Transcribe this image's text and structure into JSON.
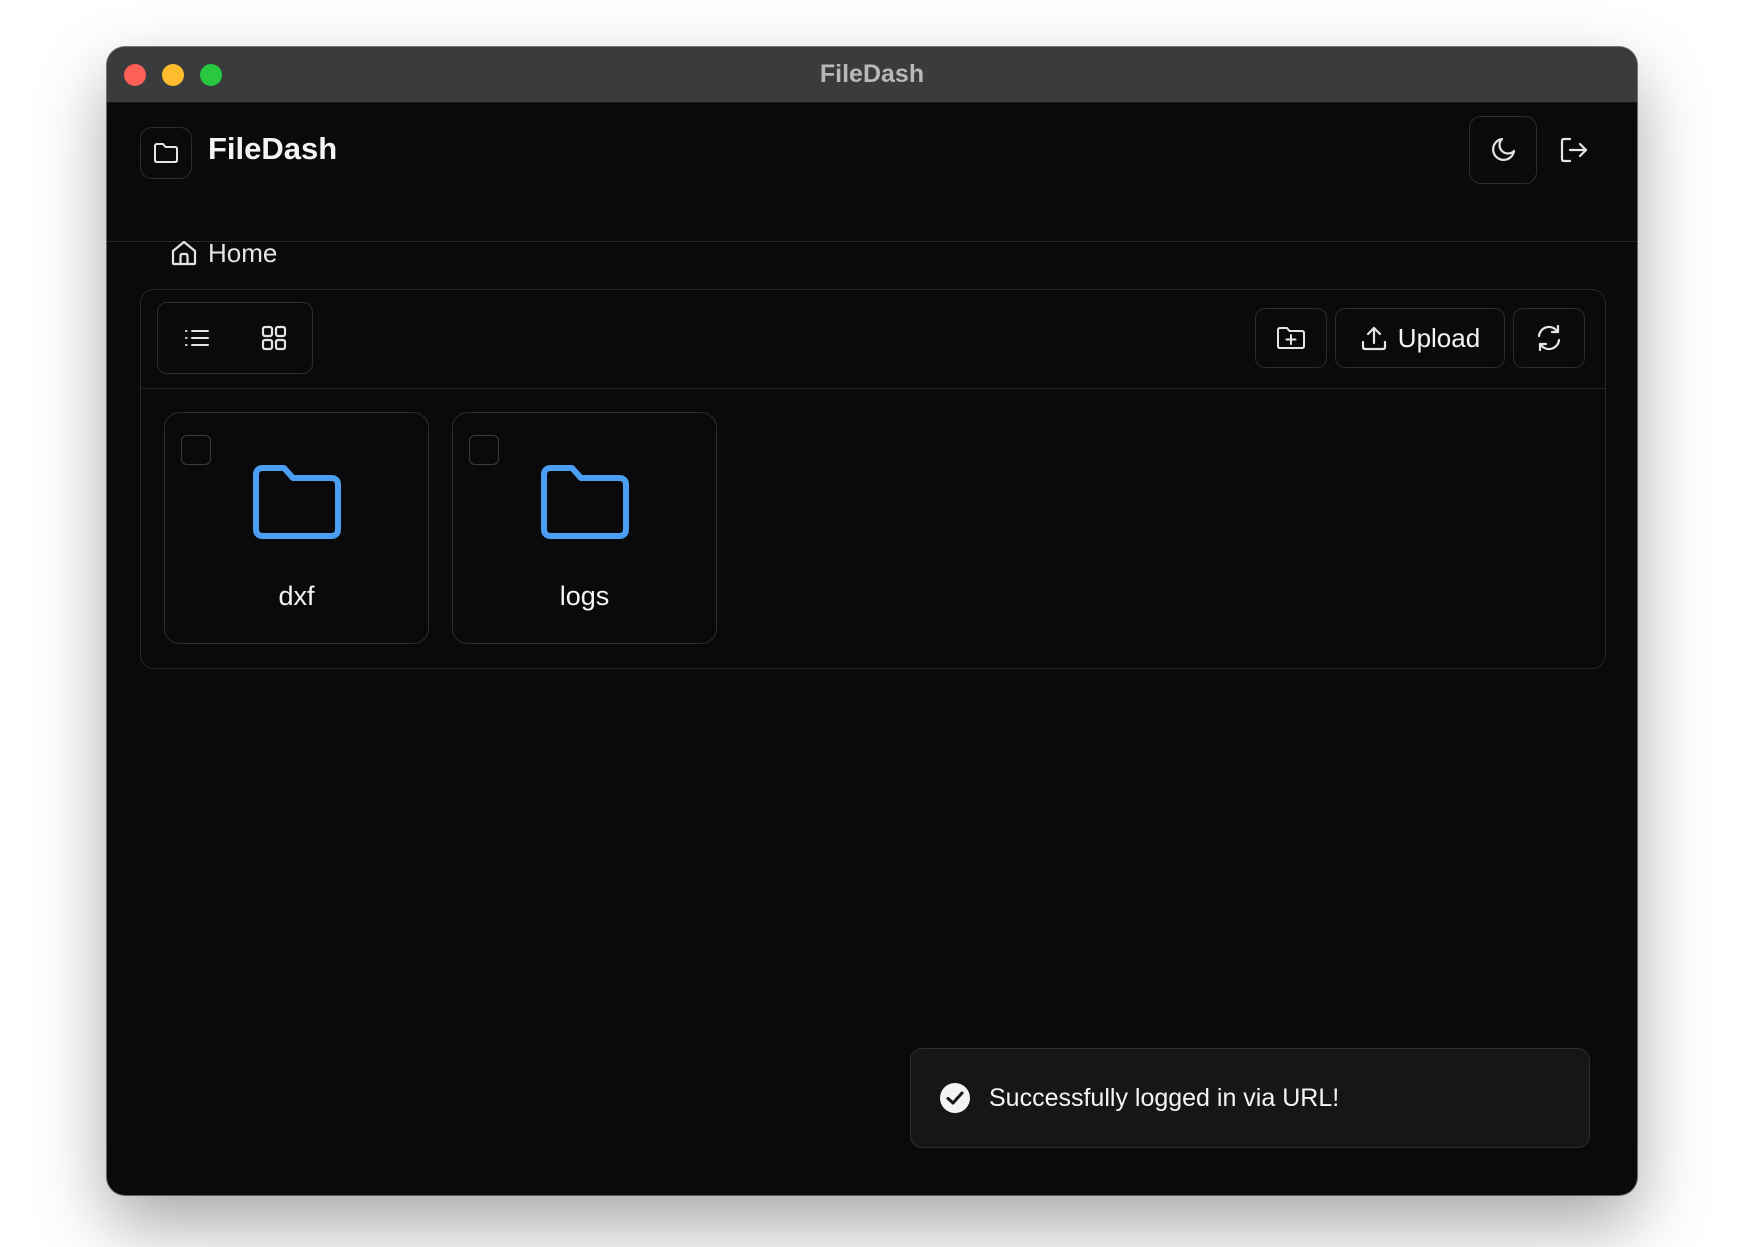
{
  "window": {
    "title": "FileDash"
  },
  "header": {
    "app_name": "FileDash",
    "logo_icon": "folder-icon",
    "theme_icon": "moon-icon",
    "logout_icon": "logout-icon"
  },
  "breadcrumb": {
    "items": [
      {
        "label": "Home",
        "icon": "home-icon"
      }
    ]
  },
  "toolbar": {
    "view_modes": [
      {
        "name": "list",
        "icon": "list-icon",
        "active": false
      },
      {
        "name": "grid",
        "icon": "grid-icon",
        "active": true
      }
    ],
    "new_folder_icon": "folder-plus-icon",
    "upload_label": "Upload",
    "upload_icon": "upload-icon",
    "refresh_icon": "refresh-icon"
  },
  "files": [
    {
      "name": "dxf",
      "type": "folder",
      "selected": false
    },
    {
      "name": "logs",
      "type": "folder",
      "selected": false
    }
  ],
  "toast": {
    "message": "Successfully logged in via URL!",
    "icon": "check-circle-icon"
  },
  "colors": {
    "background": "#0a0a0c",
    "titlebar": "#393b3d",
    "border": "#2c2d31",
    "text": "#f4f4f5",
    "folder_accent": "#4a9ff5",
    "traffic_close": "#fe5f57",
    "traffic_minimize": "#febc2e",
    "traffic_maximize": "#28c840"
  }
}
